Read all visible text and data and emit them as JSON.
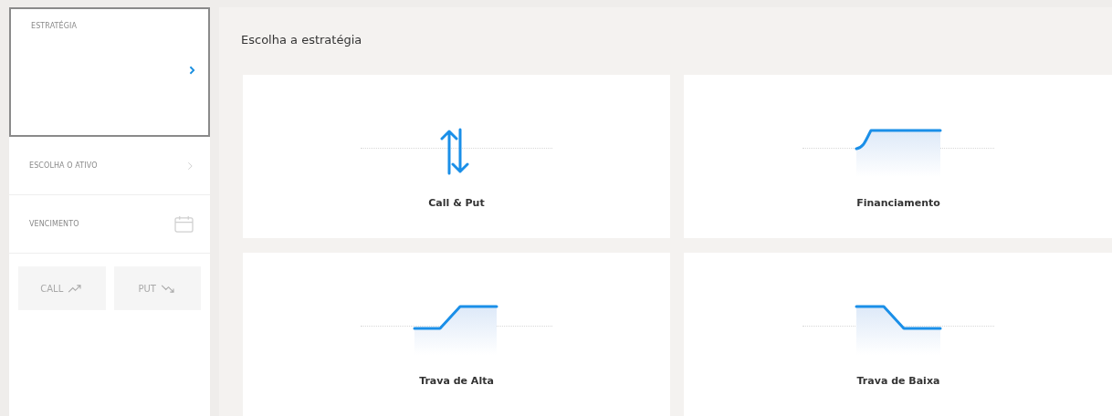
{
  "sidebar": {
    "items": [
      {
        "label": "ESTRATÉGIA",
        "kind": "select",
        "selected": true
      },
      {
        "label": "ESCOLHA O ATIVO",
        "kind": "select",
        "selected": false
      },
      {
        "label": "VENCIMENTO",
        "kind": "date",
        "selected": false
      }
    ],
    "buttons": [
      {
        "label": "CALL",
        "kind": "up",
        "disabled": true
      },
      {
        "label": "PUT",
        "kind": "down",
        "disabled": true
      }
    ]
  },
  "main": {
    "title": "Escolha a estratégia",
    "strategies": [
      {
        "label": "Call & Put",
        "kind": "arrows"
      },
      {
        "label": "Financiamento",
        "kind": "financing"
      },
      {
        "label": "Trava de Alta",
        "kind": "bull"
      },
      {
        "label": "Trava de Baixa",
        "kind": "bear"
      }
    ]
  }
}
